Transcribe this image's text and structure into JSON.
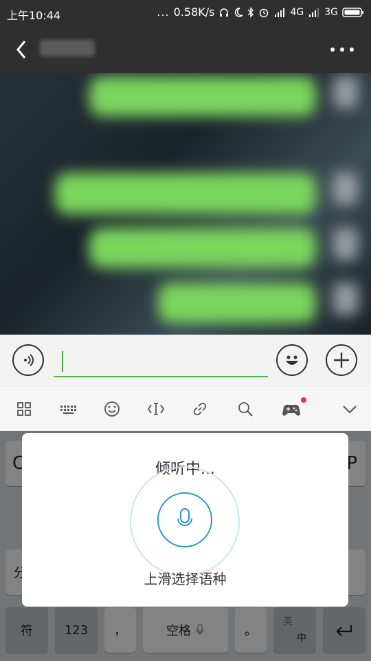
{
  "status_bar": {
    "time": "上午10:44",
    "network_speed": "0.58K/s",
    "network_primary": "4G",
    "network_secondary": "3G",
    "dots": "..."
  },
  "titlebar": {
    "back_icon": "chevron-left-icon",
    "more_icon": "more-horizontal-icon"
  },
  "input_bar": {
    "voice_icon": "voice-input-icon",
    "emoji_icon": "emoji-icon",
    "plus_icon": "plus-icon",
    "value": "",
    "accent": "#58b544"
  },
  "ime_toolbar": {
    "tools": [
      {
        "name": "grid-menu-icon"
      },
      {
        "name": "keyboard-icon"
      },
      {
        "name": "smiley-icon"
      },
      {
        "name": "text-cursor-icon"
      },
      {
        "name": "link-icon"
      },
      {
        "name": "search-icon"
      },
      {
        "name": "gamepad-icon",
        "badge": true
      },
      {
        "name": "chevron-down-icon"
      }
    ],
    "badge_color": "#e53935"
  },
  "voice_popup": {
    "title": "倾听中...",
    "hint": "上滑选择语种",
    "mic_icon": "microphone-icon",
    "accent": "#2a94c8"
  },
  "keyboard": {
    "bottom_row": {
      "symbol": "符",
      "numbers": "123",
      "comma": "，",
      "space": "空格",
      "period": "。",
      "lang_top": "英",
      "lang_bottom": "中",
      "enter_icon": "enter-icon"
    },
    "partial_left_top": "C",
    "partial_right_top": "P",
    "partial_left_mid": "分"
  }
}
